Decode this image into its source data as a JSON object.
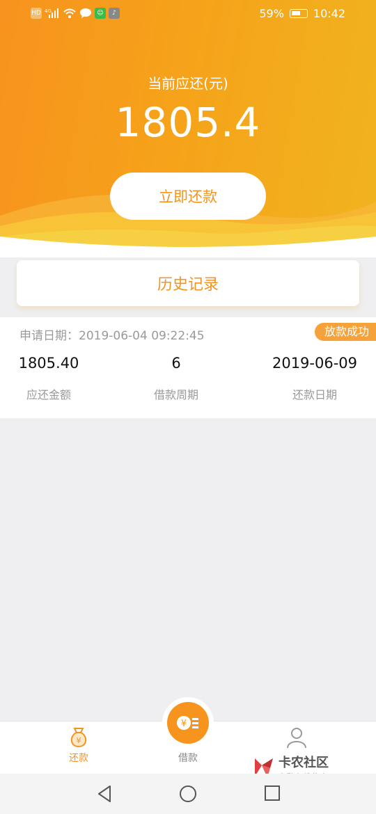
{
  "status_bar": {
    "battery": "59%",
    "time": "10:42",
    "icons": [
      "hd-icon",
      "4g-signal-icon",
      "wifi-icon",
      "message-icon",
      "wechat-icon",
      "music-icon"
    ]
  },
  "header": {
    "due_label": "当前应还(元)",
    "due_amount": "1805.4",
    "repay_button": "立即还款"
  },
  "history": {
    "title": "历史记录"
  },
  "record": {
    "apply_date_label": "申请日期：",
    "apply_date": "2019-06-04 09:22:45",
    "status": "放款成功",
    "columns": [
      {
        "value": "1805.40",
        "label": "应还金额"
      },
      {
        "value": "6",
        "label": "借款周期"
      },
      {
        "value": "2019-06-09",
        "label": "还款日期"
      }
    ]
  },
  "tabbar": {
    "tabs": [
      {
        "label": "还款",
        "icon": "money-bag-icon",
        "active": true
      },
      {
        "label": "借款",
        "icon": "coin-icon",
        "active": false
      },
      {
        "label": "",
        "icon": "user-icon",
        "active": false
      }
    ]
  },
  "watermark": {
    "title": "卡农社区",
    "subtitle": "金融在线教育"
  },
  "colors": {
    "accent": "#f09422",
    "header_start": "#f7931e",
    "header_end": "#f0b41e",
    "badge": "#f5a23a"
  }
}
